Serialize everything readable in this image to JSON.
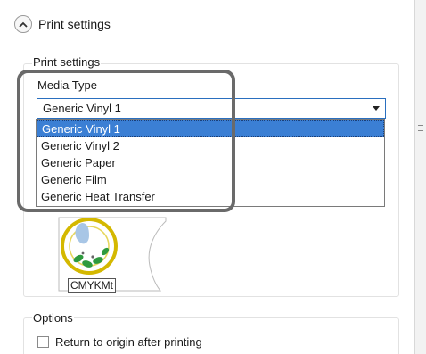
{
  "header": {
    "title": "Print settings"
  },
  "panel": {
    "legend": "Print settings"
  },
  "media_type": {
    "label": "Media Type",
    "selected": "Generic Vinyl 1",
    "options": [
      "Generic Vinyl 1",
      "Generic Vinyl 2",
      "Generic Paper",
      "Generic Film",
      "Generic Heat Transfer"
    ]
  },
  "ink": {
    "label": "CMYKMt"
  },
  "options": {
    "legend": "Options",
    "return_to_origin_label": "Return to origin after printing",
    "return_to_origin_checked": false
  },
  "colors": {
    "accent": "#3b7fd4",
    "highlight_frame": "#6a6a6a"
  }
}
